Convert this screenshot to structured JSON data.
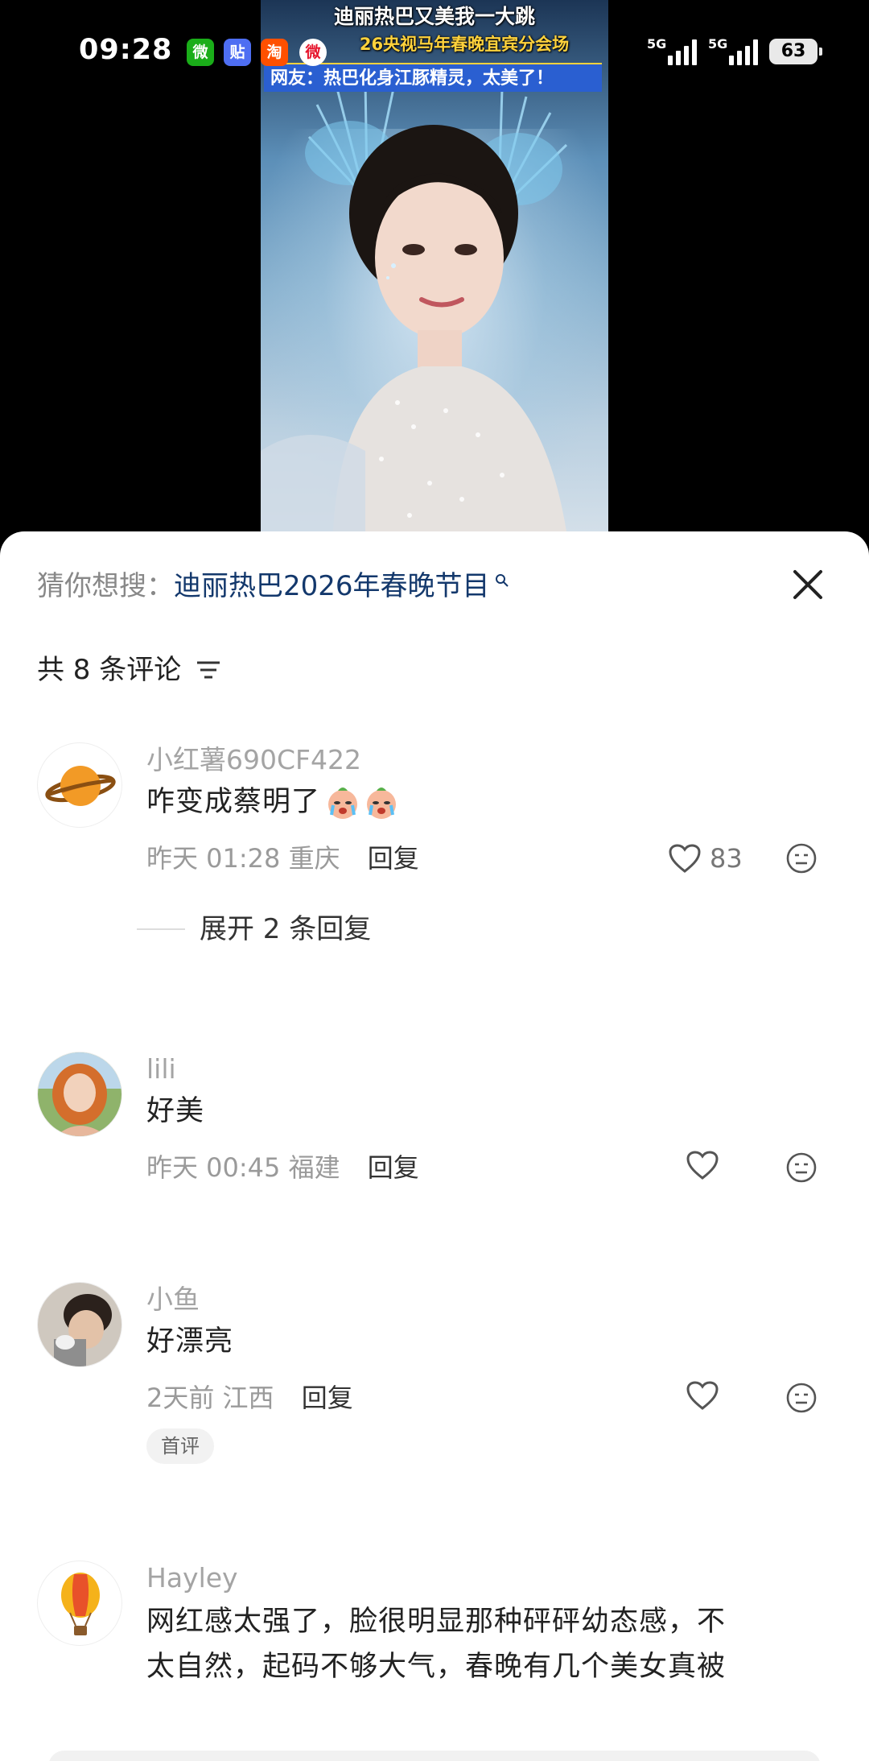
{
  "status_bar": {
    "time": "09:28",
    "app_icons": [
      {
        "name": "wechat-icon",
        "glyph": "微"
      },
      {
        "name": "tieba-icon",
        "glyph": "贴"
      },
      {
        "name": "taobao-icon",
        "glyph": "淘"
      },
      {
        "name": "weibo-icon",
        "glyph": "微"
      }
    ],
    "signal_1_label": "5G",
    "signal_2_label": "5G",
    "battery": "63"
  },
  "video": {
    "title": "迪丽热巴又美我一大跳",
    "subtitle": "26央视马年春晚宜宾分会场",
    "banner": "网友：热巴化身江豚精灵，太美了！"
  },
  "comments_panel": {
    "suggest_prefix": "猜你想搜：",
    "suggest_query": "迪丽热巴2026年春晚节目",
    "count_text": "共 8 条评论",
    "comments": [
      {
        "username": "小红薯690CF422",
        "text": "咋变成蔡明了",
        "time_location": "昨天 01:28 重庆",
        "reply_label": "回复",
        "like_count": "83",
        "expand_label": "展开 2 条回复",
        "avatar": "planet-icon"
      },
      {
        "username": "lili",
        "text": "好美",
        "time_location": "昨天 00:45 福建",
        "reply_label": "回复",
        "avatar": "photo-avatar-woman"
      },
      {
        "username": "小鱼",
        "text": "好漂亮",
        "time_location": "2天前 江西",
        "reply_label": "回复",
        "tag": "首评",
        "avatar": "photo-avatar-man"
      },
      {
        "username": "Hayley",
        "text_line1": "网红感太强了，脸很明显那种砰砰幼态感，不",
        "text_line2": "太自然，起码不够大气，春晚有几个美女真被",
        "avatar": "hot-air-balloon-icon"
      }
    ]
  },
  "colors": {
    "accent_query": "#13386c",
    "meta_gray": "#9a9a9a",
    "banner_blue": "#2a5fd1",
    "subtitle_yellow": "#ffd23c"
  }
}
